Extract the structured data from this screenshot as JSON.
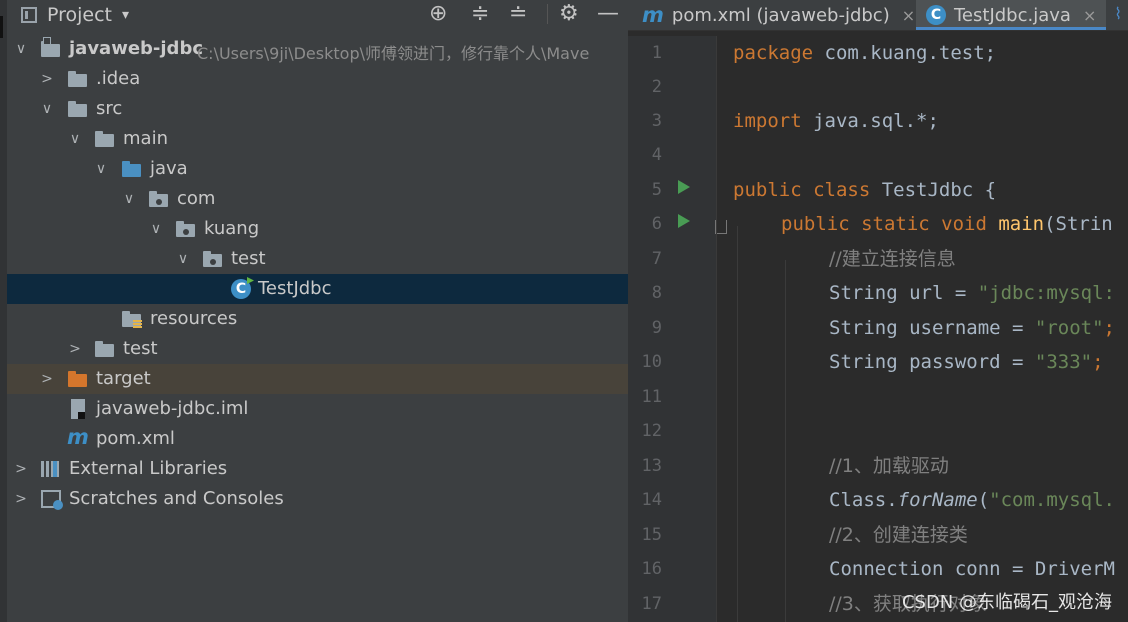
{
  "project_panel": {
    "title": "Project",
    "dropdown": "▾",
    "header_buttons": {
      "locate": "⊕",
      "expand": "≑",
      "collapse": "≐",
      "settings": "⚙",
      "hide": "—"
    },
    "tree": [
      {
        "arrow": "∨",
        "label": "javaweb-jdbc",
        "path": "C:\\Users\\9ji\\Desktop\\师傅领进门，修行靠个人\\Mave"
      },
      {
        "arrow": ">",
        "label": ".idea"
      },
      {
        "arrow": "∨",
        "label": "src"
      },
      {
        "arrow": "∨",
        "label": "main"
      },
      {
        "arrow": "∨",
        "label": "java"
      },
      {
        "arrow": "∨",
        "label": "com"
      },
      {
        "arrow": "∨",
        "label": "kuang"
      },
      {
        "arrow": "∨",
        "label": "test"
      },
      {
        "arrow": "",
        "label": "TestJdbc",
        "icon_letter": "C"
      },
      {
        "arrow": "",
        "label": "resources"
      },
      {
        "arrow": ">",
        "label": "test"
      },
      {
        "arrow": ">",
        "label": "target"
      },
      {
        "arrow": "",
        "label": "javaweb-jdbc.iml"
      },
      {
        "arrow": "",
        "label": "pom.xml",
        "icon_letter": "m"
      },
      {
        "arrow": ">",
        "label": "External Libraries"
      },
      {
        "arrow": ">",
        "label": "Scratches and Consoles"
      }
    ]
  },
  "editor": {
    "tabs": [
      {
        "label": "pom.xml (javaweb-jdbc)",
        "icon": "m",
        "close": "×"
      },
      {
        "label": "TestJdbc.java",
        "icon": "C",
        "close": "×"
      }
    ],
    "line_numbers": [
      "1",
      "2",
      "3",
      "4",
      "5",
      "6",
      "7",
      "8",
      "9",
      "10",
      "11",
      "12",
      "13",
      "14",
      "15",
      "16",
      "17"
    ],
    "code": {
      "l1_kw": "package",
      "l1_rest": " com.kuang.test;",
      "l3_kw": "import",
      "l3_rest": " java.sql.*;",
      "l5_kw": "public class",
      "l5_rest": " TestJdbc {",
      "l6_kw": "public static void",
      "l6_fn": " main",
      "l6_rest": "(Strin",
      "l7_cmt": "//建立连接信息",
      "l8_plain": "String url = ",
      "l8_str": "\"jdbc:mysql:",
      "l9_plain": "String username = ",
      "l9_str": "\"root\"",
      "l9_end": ";",
      "l10_plain": "String password = ",
      "l10_str": "\"333\"",
      "l10_end": ";",
      "l13_cmt": "//1、加载驱动",
      "l14_plain": "Class.",
      "l14_it": "forName",
      "l14_paren": "(",
      "l14_str": "\"com.mysql.",
      "l15_cmt": "//2、创建连接类",
      "l16_plain": "Connection conn = DriverM",
      "l17_cmt": "//3、获取执行对象"
    }
  },
  "watermark": "CSDN @东临碣石_观沧海",
  "colors": {
    "panel_bg": "#3c3f41",
    "editor_bg": "#2b2b2b",
    "selection": "#0d293e",
    "keyword": "#cc7832",
    "string": "#6a8759",
    "comment": "#808080",
    "text": "#a9b7c6",
    "function": "#ffc66d"
  }
}
